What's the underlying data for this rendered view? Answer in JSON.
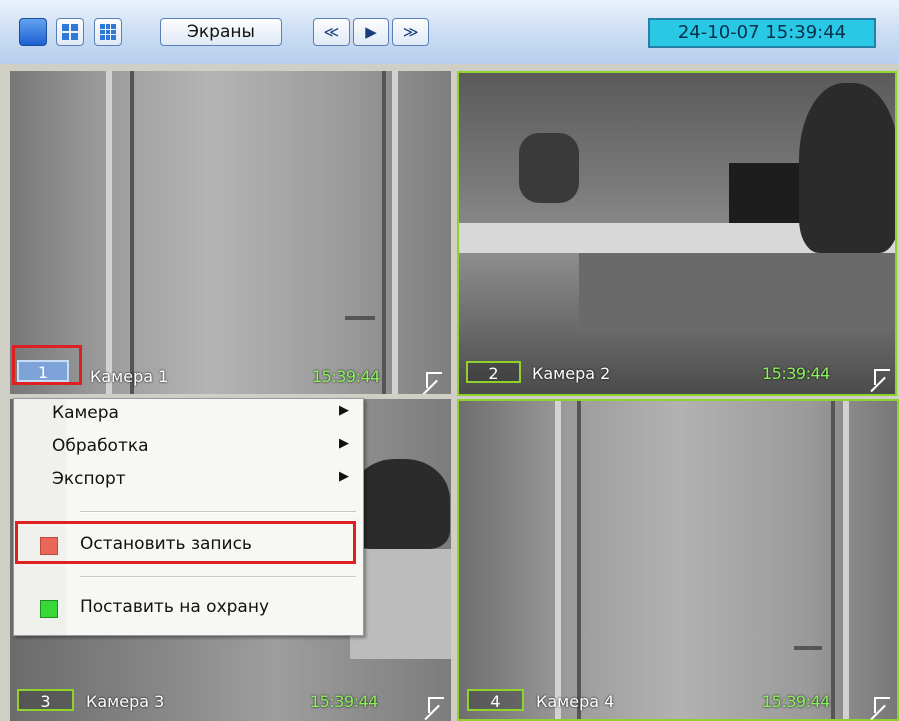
{
  "toolbar": {
    "screens_label": "Экраны",
    "nav": {
      "prev": "≪",
      "play": "▶",
      "next": "≫"
    },
    "datetime": "24-10-07   15:39:44"
  },
  "cameras": [
    {
      "number": "1",
      "label": "Камера 1",
      "time": "15:39:44"
    },
    {
      "number": "2",
      "label": "Камера 2",
      "time": "15:39:44"
    },
    {
      "number": "3",
      "label": "Камера 3",
      "time": "15:39:44"
    },
    {
      "number": "4",
      "label": "Камера 4",
      "time": "15:39:44"
    }
  ],
  "context_menu": {
    "items": [
      {
        "label": "Камера"
      },
      {
        "label": "Обработка"
      },
      {
        "label": "Экспорт"
      },
      {
        "label": "Остановить запись"
      },
      {
        "label": "Поставить на охрану"
      }
    ]
  },
  "colors": {
    "frame_active": "#8fd22b",
    "time_text": "#8cf25c",
    "clock_bg": "#29c9e6",
    "highlight": "#e02020",
    "record_icon": "#e8685a",
    "arm_icon": "#38d838"
  }
}
